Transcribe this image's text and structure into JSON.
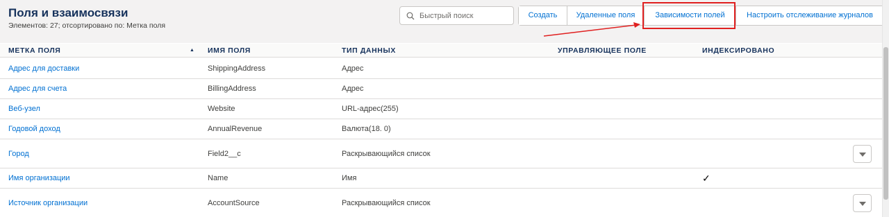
{
  "header": {
    "title": "Поля и взаимосвязи",
    "subtitle": "Элементов: 27; отсортировано по: Метка поля"
  },
  "search": {
    "placeholder": "Быстрый поиск",
    "icon": "search-icon"
  },
  "buttons": {
    "create": "Создать",
    "deleted_fields": "Удаленные поля",
    "field_dependencies": "Зависимости полей",
    "track_history": "Настроить отслеживание журналов"
  },
  "table": {
    "columns": [
      "Метка поля",
      "Имя поля",
      "Тип данных",
      "Управляющее поле",
      "Индексировано"
    ],
    "rows": [
      {
        "label": "Адрес для доставки",
        "name": "ShippingAddress",
        "type": "Адрес",
        "controlling": "",
        "indexed": false,
        "menu": false
      },
      {
        "label": "Адрес для счета",
        "name": "BillingAddress",
        "type": "Адрес",
        "controlling": "",
        "indexed": false,
        "menu": false
      },
      {
        "label": "Веб-узел",
        "name": "Website",
        "type": "URL-адрес(255)",
        "controlling": "",
        "indexed": false,
        "menu": false
      },
      {
        "label": "Годовой доход",
        "name": "AnnualRevenue",
        "type": "Валюта(18. 0)",
        "controlling": "",
        "indexed": false,
        "menu": false
      },
      {
        "label": "Город",
        "name": "Field2__c",
        "type": "Раскрывающийся список",
        "controlling": "",
        "indexed": false,
        "menu": true
      },
      {
        "label": "Имя организации",
        "name": "Name",
        "type": "Имя",
        "controlling": "",
        "indexed": true,
        "menu": false
      },
      {
        "label": "Источник организации",
        "name": "AccountSource",
        "type": "Раскрывающийся список",
        "controlling": "",
        "indexed": false,
        "menu": true
      }
    ]
  },
  "colors": {
    "link": "#0070d2",
    "header_text": "#16325c",
    "highlight": "#e02020"
  }
}
